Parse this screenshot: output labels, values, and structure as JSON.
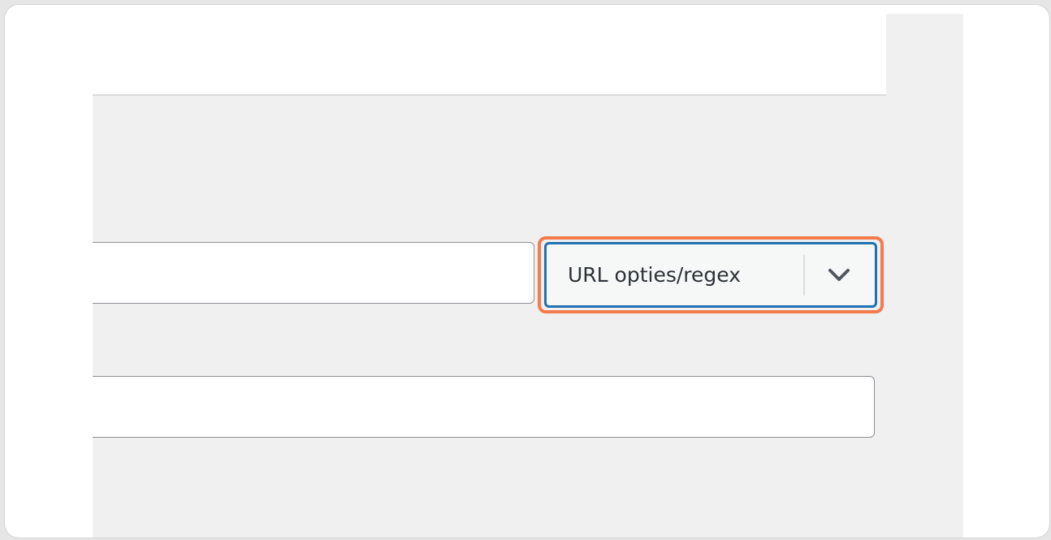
{
  "form": {
    "url_input": {
      "value": "",
      "placeholder": ""
    },
    "match_select": {
      "selected": "URL opties/regex",
      "chevron_icon": "chevron-down-icon"
    },
    "target_input": {
      "value": "",
      "placeholder": ""
    }
  },
  "colors": {
    "highlight": "#f47b4c",
    "focus_border": "#2271b1",
    "background": "#f0f0f1"
  }
}
